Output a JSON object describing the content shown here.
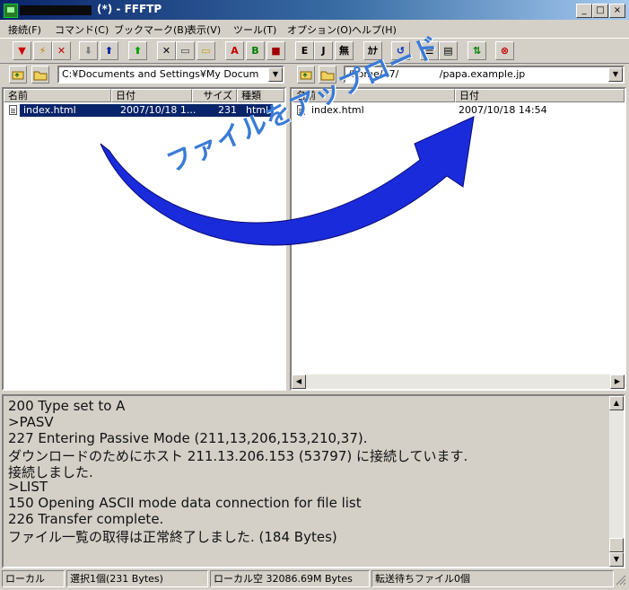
{
  "window": {
    "title": "(*) - FFFTP",
    "buttons": {
      "minimize": "_",
      "maximize": "□",
      "close": "×"
    }
  },
  "menu": [
    {
      "label": "接続(F)"
    },
    {
      "label": "コマンド(C)"
    },
    {
      "label": "ブックマーク(B)"
    },
    {
      "label": "表示(V)"
    },
    {
      "label": "ツール(T)"
    },
    {
      "label": "オプション(O)"
    },
    {
      "label": "ヘルプ(H)"
    }
  ],
  "toolbar": {
    "buttons": [
      {
        "name": "connect-icon",
        "glyph": "▼",
        "color": "#d00000"
      },
      {
        "name": "quick-connect-icon",
        "glyph": "⚡",
        "color": "#c08000"
      },
      {
        "name": "disconnect-icon",
        "glyph": "✕",
        "color": "#c00000"
      },
      {
        "name": "download-icon",
        "glyph": "⬇",
        "color": "#808080"
      },
      {
        "name": "upload-icon",
        "glyph": "⬆",
        "color": "#0020a0"
      },
      {
        "name": "mirror-upload-icon",
        "glyph": "⬆",
        "color": "#00a000"
      },
      {
        "name": "delete-icon",
        "glyph": "✕",
        "color": "#000000"
      },
      {
        "name": "rename-icon",
        "glyph": "▭",
        "color": "#404040"
      },
      {
        "name": "new-folder-icon",
        "glyph": "▭",
        "color": "#c0a000"
      },
      {
        "name": "ascii-mode-icon",
        "glyph": "A",
        "color": "#c00000"
      },
      {
        "name": "binary-mode-icon",
        "glyph": "B",
        "color": "#008000"
      },
      {
        "name": "auto-mode-icon",
        "glyph": "■",
        "color": "#a00000"
      },
      {
        "name": "euc-kanji-icon",
        "glyph": "E",
        "color": "#000000"
      },
      {
        "name": "jis-kanji-icon",
        "glyph": "J",
        "color": "#000000"
      },
      {
        "name": "no-conversion-icon",
        "glyph": "無",
        "color": "#000000"
      },
      {
        "name": "kana-convert-icon",
        "glyph": "ｶﾅ",
        "color": "#000000"
      },
      {
        "name": "refresh-icon",
        "glyph": "↺",
        "color": "#0030c0"
      },
      {
        "name": "list-view-icon",
        "glyph": "☰",
        "color": "#000000"
      },
      {
        "name": "detail-view-icon",
        "glyph": "▤",
        "color": "#000000"
      },
      {
        "name": "sync-icon",
        "glyph": "⇅",
        "color": "#008000"
      },
      {
        "name": "stop-icon",
        "glyph": "⊗",
        "color": "#c00000"
      }
    ]
  },
  "local": {
    "path": "C:¥Documents and Settings¥My Docum",
    "columns": [
      "名前",
      "日付",
      "サイズ",
      "種類"
    ],
    "files": [
      {
        "name": "index.html",
        "date": "2007/10/18 1...",
        "size": "231",
        "type": "html"
      }
    ]
  },
  "remote": {
    "path": "/home/77/             /papa.example.jp",
    "columns": [
      "名前",
      "日付"
    ],
    "files": [
      {
        "name": "index.html",
        "date": "2007/10/18 14:54"
      }
    ]
  },
  "annotation": {
    "text": "ファイルをアップロード",
    "arrow_color": "#1a2bdc"
  },
  "log": [
    "200 Type set to A",
    ">PASV",
    "227 Entering Passive Mode (211,13,206,153,210,37).",
    "ダウンロードのためにホスト 211.13.206.153 (53797) に接続しています.",
    "接続しました.",
    ">LIST",
    "150 Opening ASCII mode data connection for file list",
    "226 Transfer complete.",
    "ファイル一覧の取得は正常終了しました. (184 Bytes)"
  ],
  "status": {
    "mode": "ローカル",
    "selected": "選択1個(231 Bytes)",
    "free": "ローカル空 32086.69M Bytes",
    "queue": "転送待ちファイル0個"
  }
}
